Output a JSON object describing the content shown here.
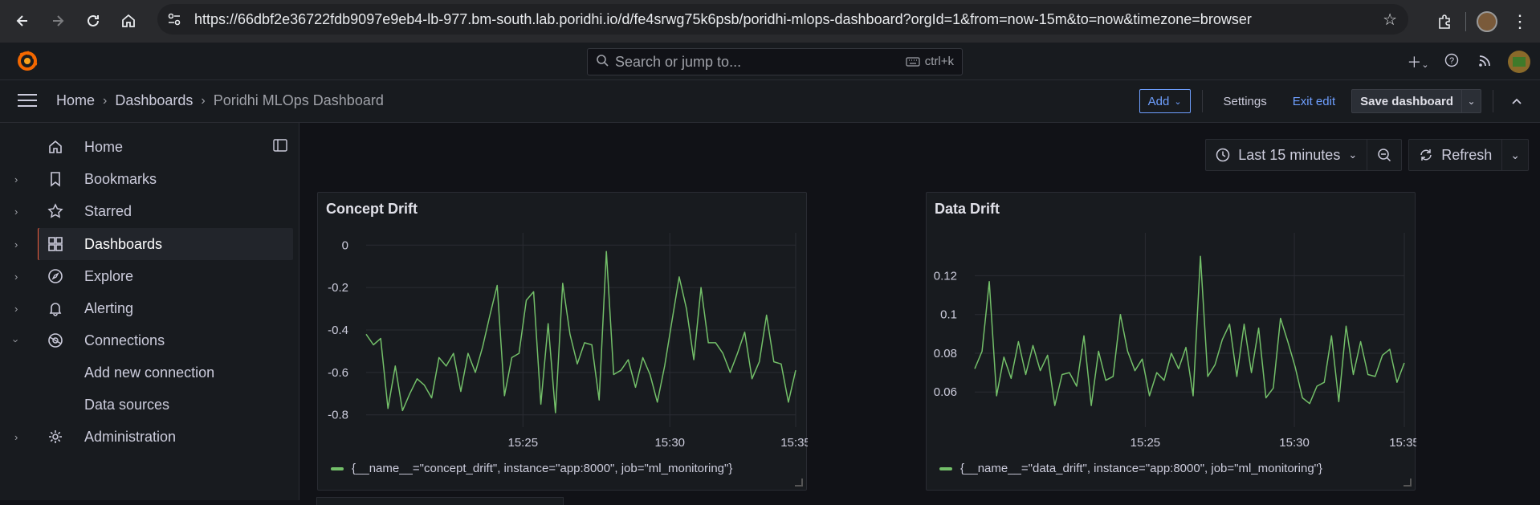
{
  "browser": {
    "url": "https://66dbf2e36722fdb9097e9eb4-lb-977.bm-south.lab.poridhi.io/d/fe4srwg75k6psb/poridhi-mlops-dashboard?orgId=1&from=now-15m&to=now&timezone=browser",
    "icons": [
      "back-icon",
      "forward-icon",
      "reload-icon",
      "home-icon",
      "site-info-icon",
      "bookmark-star-icon",
      "extensions-icon",
      "profile-avatar",
      "menu-kebab-icon"
    ]
  },
  "topbar": {
    "search_placeholder": "Search or jump to...",
    "search_shortcut": "ctrl+k",
    "icons": [
      "plus-icon",
      "help-icon",
      "news-feed-icon",
      "user-avatar"
    ]
  },
  "breadcrumb": {
    "items": [
      "Home",
      "Dashboards",
      "Poridhi MLOps Dashboard"
    ]
  },
  "actions": {
    "add": "Add",
    "settings": "Settings",
    "exit_edit": "Exit edit",
    "save": "Save dashboard"
  },
  "sidebar": {
    "items": [
      {
        "label": "Home",
        "icon": "home-icon"
      },
      {
        "label": "Bookmarks",
        "icon": "bookmark-icon"
      },
      {
        "label": "Starred",
        "icon": "star-icon"
      },
      {
        "label": "Dashboards",
        "icon": "dashboards-icon"
      },
      {
        "label": "Explore",
        "icon": "compass-icon"
      },
      {
        "label": "Alerting",
        "icon": "bell-icon"
      },
      {
        "label": "Connections",
        "icon": "connections-icon"
      },
      {
        "label": "Add new connection"
      },
      {
        "label": "Data sources"
      },
      {
        "label": "Administration",
        "icon": "gear-icon"
      }
    ]
  },
  "timepicker": {
    "range": "Last 15 minutes",
    "refresh": "Refresh"
  },
  "colors": {
    "series": "#73bf69",
    "accent": "#6e9fff",
    "active_bar": "#f55f3e"
  },
  "panels": [
    {
      "title": "Concept Drift",
      "legend": "{__name__=\"concept_drift\", instance=\"app:8000\", job=\"ml_monitoring\"}"
    },
    {
      "title": "Data Drift",
      "legend": "{__name__=\"data_drift\", instance=\"app:8000\", job=\"ml_monitoring\"}"
    }
  ],
  "chart_data": [
    {
      "type": "line",
      "title": "Concept Drift",
      "ylim": [
        -0.82,
        0.02
      ],
      "y_ticks": [
        "0",
        "-0.2",
        "-0.4",
        "-0.6",
        "-0.8"
      ],
      "y_tick_values": [
        0,
        -0.2,
        -0.4,
        -0.6,
        -0.8
      ],
      "x_ticks": [
        "15:25",
        "15:30",
        "15:35"
      ],
      "series": [
        {
          "name": "{__name__=\"concept_drift\", instance=\"app:8000\", job=\"ml_monitoring\"}",
          "values": [
            -0.42,
            -0.47,
            -0.44,
            -0.77,
            -0.57,
            -0.78,
            -0.7,
            -0.63,
            -0.66,
            -0.72,
            -0.53,
            -0.57,
            -0.51,
            -0.69,
            -0.51,
            -0.6,
            -0.48,
            -0.33,
            -0.19,
            -0.71,
            -0.53,
            -0.51,
            -0.26,
            -0.22,
            -0.75,
            -0.37,
            -0.79,
            -0.18,
            -0.42,
            -0.56,
            -0.46,
            -0.47,
            -0.73,
            -0.03,
            -0.61,
            -0.59,
            -0.54,
            -0.67,
            -0.53,
            -0.61,
            -0.74,
            -0.57,
            -0.36,
            -0.15,
            -0.3,
            -0.54,
            -0.2,
            -0.46,
            -0.46,
            -0.51,
            -0.6,
            -0.51,
            -0.41,
            -0.63,
            -0.55,
            -0.33,
            -0.55,
            -0.56,
            -0.74,
            -0.59
          ]
        }
      ]
    },
    {
      "type": "line",
      "title": "Data Drift",
      "ylim": [
        0.046,
        0.138
      ],
      "y_ticks": [
        "0.12",
        "0.1",
        "0.08",
        "0.06"
      ],
      "y_tick_values": [
        0.12,
        0.1,
        0.08,
        0.06
      ],
      "x_ticks": [
        "15:25",
        "15:30",
        "15:35"
      ],
      "series": [
        {
          "name": "{__name__=\"data_drift\", instance=\"app:8000\", job=\"ml_monitoring\"}",
          "values": [
            0.072,
            0.081,
            0.117,
            0.058,
            0.078,
            0.067,
            0.086,
            0.069,
            0.084,
            0.071,
            0.079,
            0.053,
            0.069,
            0.07,
            0.063,
            0.089,
            0.053,
            0.081,
            0.066,
            0.068,
            0.1,
            0.081,
            0.071,
            0.077,
            0.058,
            0.07,
            0.066,
            0.08,
            0.072,
            0.083,
            0.058,
            0.13,
            0.068,
            0.074,
            0.087,
            0.095,
            0.068,
            0.095,
            0.07,
            0.093,
            0.057,
            0.062,
            0.098,
            0.086,
            0.073,
            0.057,
            0.054,
            0.063,
            0.065,
            0.089,
            0.055,
            0.094,
            0.069,
            0.086,
            0.069,
            0.068,
            0.079,
            0.082,
            0.065,
            0.075
          ]
        }
      ]
    }
  ]
}
